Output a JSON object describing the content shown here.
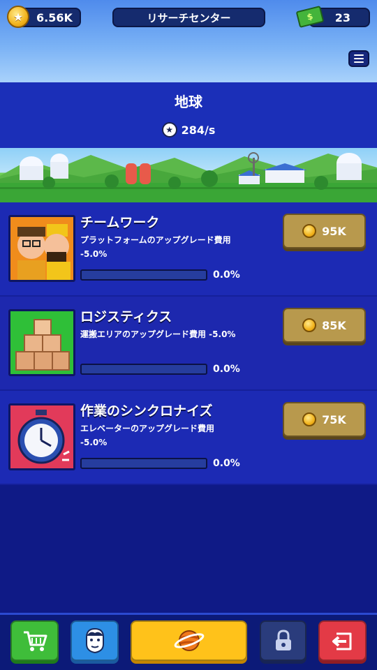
{
  "top_bar": {
    "coins": "6.56K",
    "title": "リサーチセンター",
    "cash": "23",
    "cash_icon_glyph": "$"
  },
  "header": {
    "planet_name": "地球",
    "rate": "284/s"
  },
  "research_items": [
    {
      "title": "チームワーク",
      "description_line1": "プラットフォームのアップグレード費用",
      "description_line2": "-5.0%",
      "progress_label": "0.0%",
      "progress": 0.0,
      "price": "95K",
      "thumb_bg": "#f08c1c",
      "icon": "workers-icon"
    },
    {
      "title": "ロジスティクス",
      "description_line1": "運搬エリアのアップグレード費用 -5.0%",
      "description_line2": "",
      "progress_label": "0.0%",
      "progress": 0.0,
      "price": "85K",
      "thumb_bg": "#2fbf38",
      "icon": "boxes-icon"
    },
    {
      "title": "作業のシンクロナイズ",
      "description_line1": "エレベーターのアップグレード費用",
      "description_line2": "-5.0%",
      "progress_label": "0.0%",
      "progress": 0.0,
      "price": "75K",
      "thumb_bg": "#e23a5a",
      "icon": "stopwatch-icon"
    }
  ],
  "bottom_nav": [
    {
      "name": "shop",
      "icon": "cart-icon"
    },
    {
      "name": "managers",
      "icon": "manager-face-icon"
    },
    {
      "name": "research",
      "icon": "planet-icon"
    },
    {
      "name": "locked",
      "icon": "lock-icon"
    },
    {
      "name": "back",
      "icon": "return-icon"
    }
  ],
  "colors": {
    "background": "#0f1a86",
    "card": "#1c2ab4",
    "price_button": "#b8994d",
    "coin": "#f2b31c"
  }
}
